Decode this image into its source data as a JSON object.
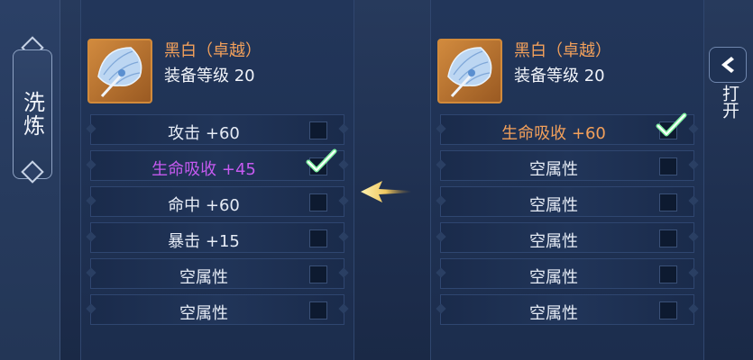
{
  "sidebar": {
    "tab_label": "洗炼"
  },
  "left_panel": {
    "item_name": "黑白（卓越）",
    "item_level": "装备等级 20",
    "attributes": [
      {
        "text": "攻击 +60",
        "checked": false,
        "color": "#e6ecf6"
      },
      {
        "text": "生命吸收 +45",
        "checked": true,
        "color": "#c55af0"
      },
      {
        "text": "命中 +60",
        "checked": false,
        "color": "#e6ecf6"
      },
      {
        "text": "暴击 +15",
        "checked": false,
        "color": "#e6ecf6"
      },
      {
        "text": "空属性",
        "checked": false,
        "color": "#e6ecf6"
      },
      {
        "text": "空属性",
        "checked": false,
        "color": "#e6ecf6"
      }
    ]
  },
  "right_panel": {
    "item_name": "黑白（卓越）",
    "item_level": "装备等级 20",
    "attributes": [
      {
        "text": "生命吸收 +60",
        "checked": true,
        "color": "#f3a05a"
      },
      {
        "text": "空属性",
        "checked": false,
        "color": "#e6ecf6"
      },
      {
        "text": "空属性",
        "checked": false,
        "color": "#e6ecf6"
      },
      {
        "text": "空属性",
        "checked": false,
        "color": "#e6ecf6"
      },
      {
        "text": "空属性",
        "checked": false,
        "color": "#e6ecf6"
      },
      {
        "text": "空属性",
        "checked": false,
        "color": "#e6ecf6"
      }
    ]
  },
  "transfer_icon": "transfer-arrow-left-icon",
  "open_button": {
    "label": "打开",
    "icon": "chevron-left-icon"
  }
}
